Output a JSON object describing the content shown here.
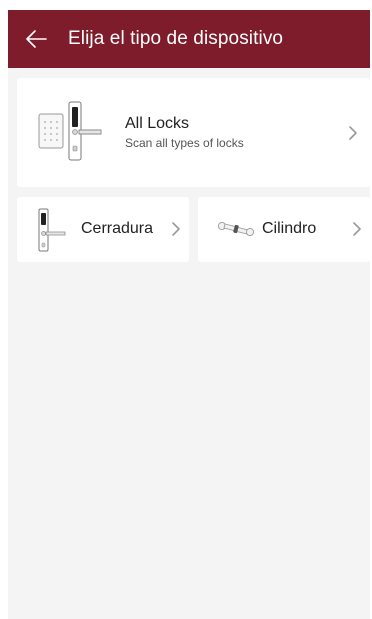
{
  "header": {
    "title": "Elija el tipo de dispositivo",
    "back_icon": "arrow-left-icon",
    "background_color": "#7e1c2b"
  },
  "all_locks": {
    "title": "All Locks",
    "subtitle": "Scan all types of locks",
    "icon": "keypad-door-lock-image",
    "chevron_icon": "chevron-right-icon"
  },
  "categories": [
    {
      "label": "Cerradura",
      "icon": "door-lock-handle-image",
      "chevron_icon": "chevron-right-icon"
    },
    {
      "label": "Cilindro",
      "icon": "lock-cylinder-image",
      "chevron_icon": "chevron-right-icon"
    }
  ]
}
